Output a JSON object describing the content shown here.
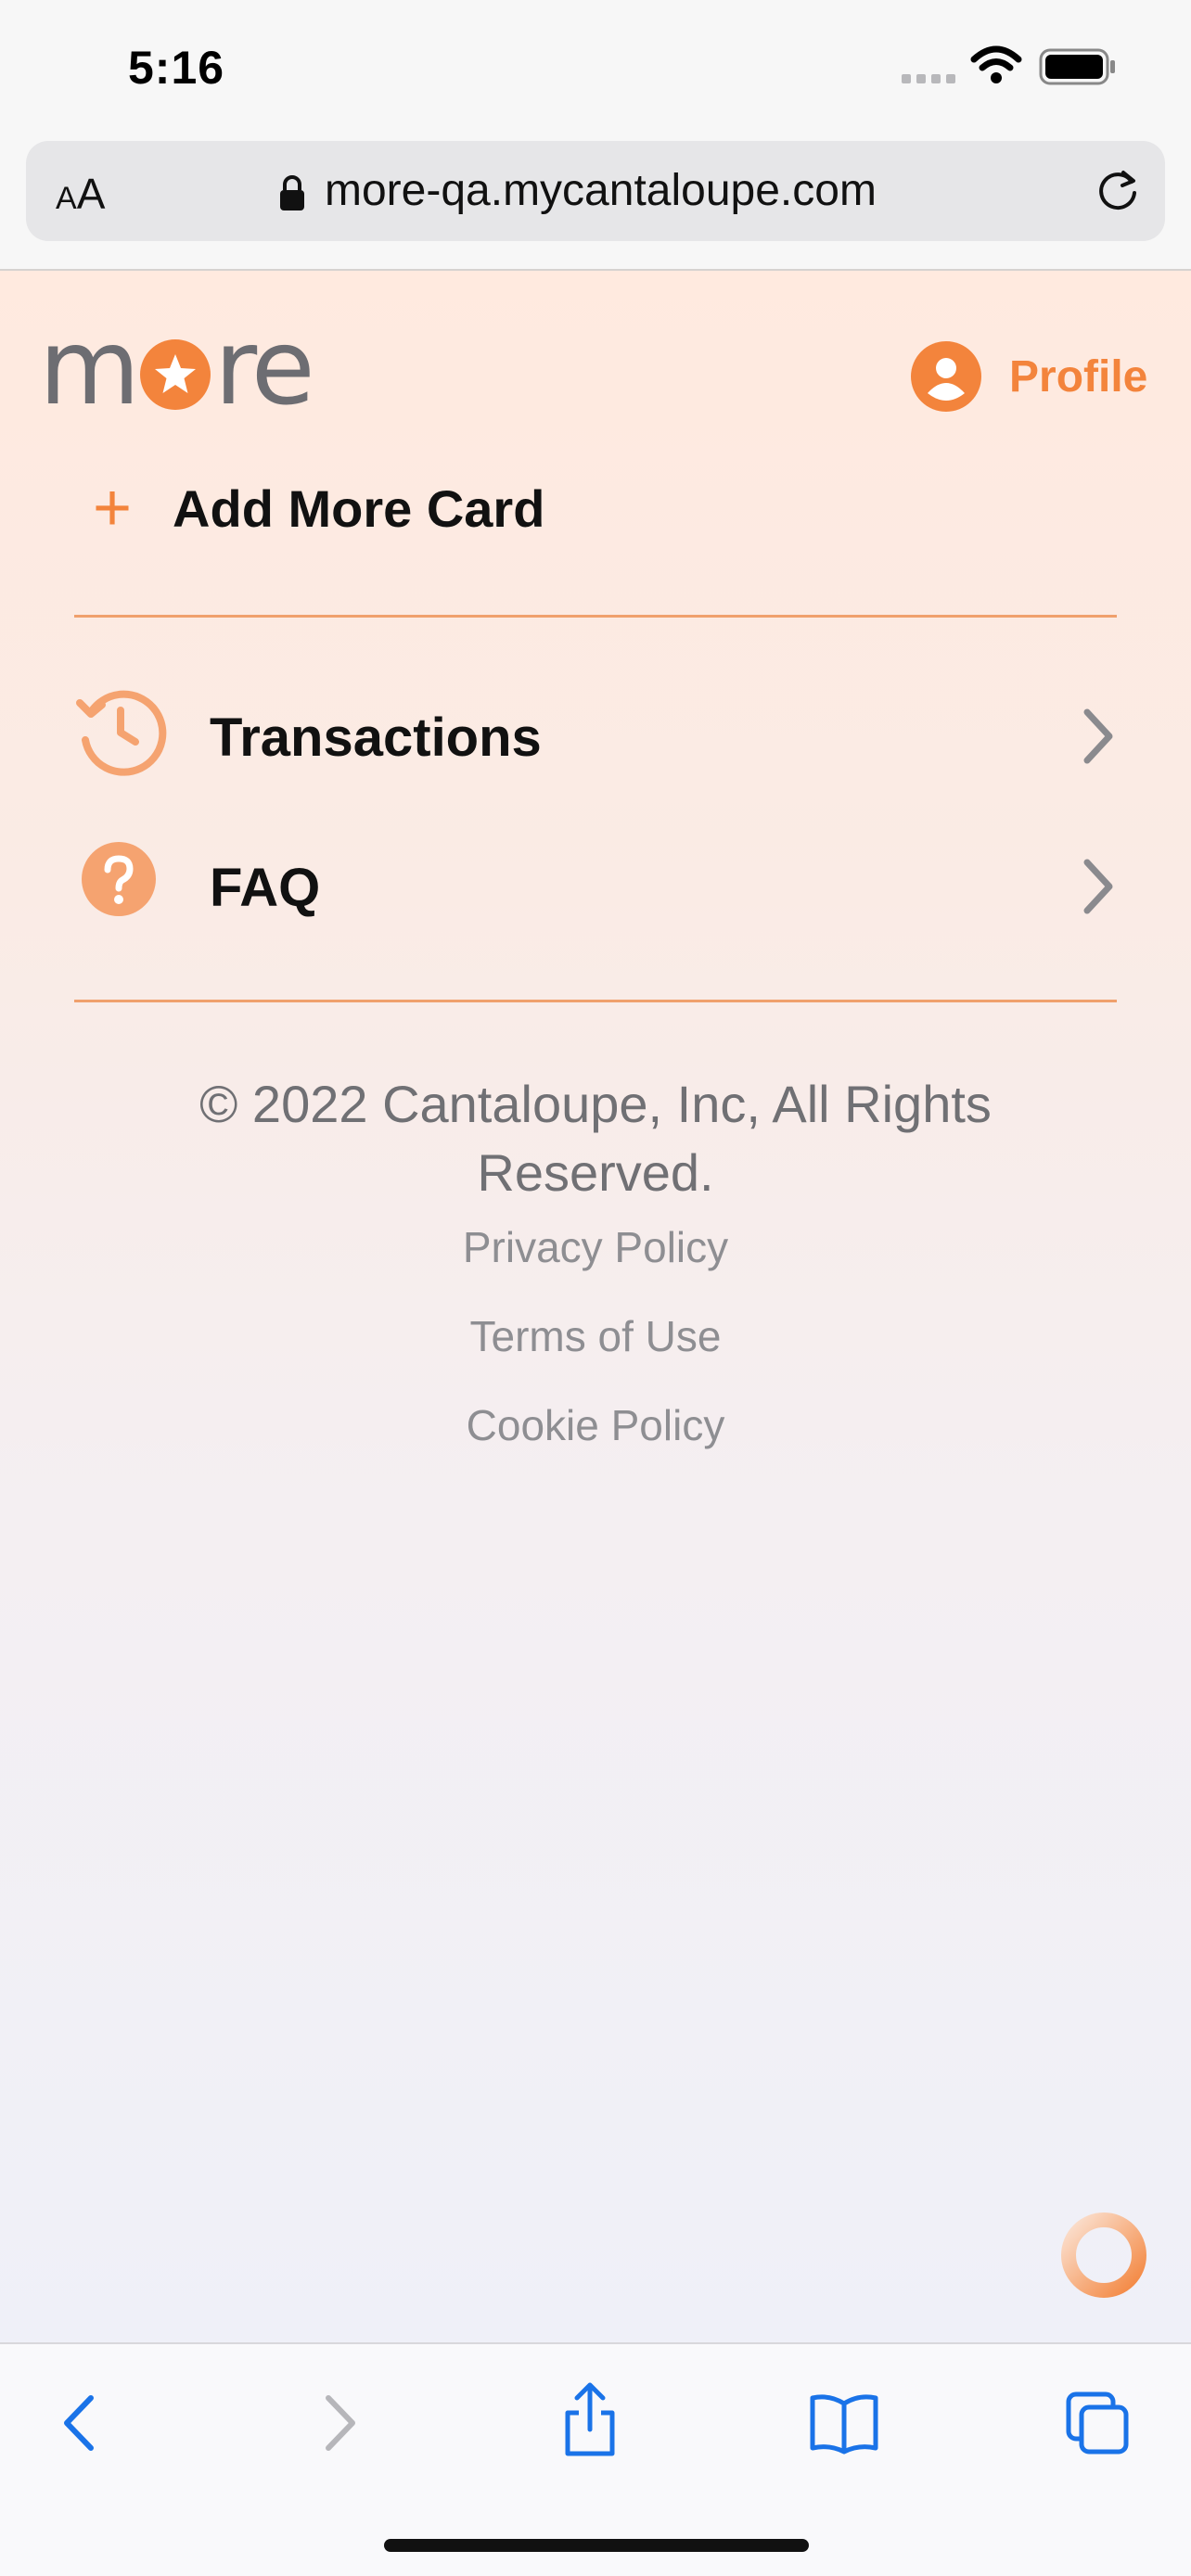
{
  "status_bar": {
    "time": "5:16",
    "icons": [
      "signal-icon",
      "wifi-icon",
      "battery-icon"
    ]
  },
  "browser": {
    "text_size_small": "A",
    "text_size_large": "A",
    "url": "more-qa.mycantaloupe.com",
    "icons": [
      "lock-icon",
      "reload-icon"
    ]
  },
  "header": {
    "logo_alt": "more",
    "logo_left": "m",
    "logo_right": "re",
    "profile_label": "Profile"
  },
  "menu": {
    "add_card": {
      "icon": "+",
      "label": "Add More Card"
    },
    "items": [
      {
        "label": "Transactions",
        "icon": "history-clock-icon"
      },
      {
        "label": "FAQ",
        "icon": "question-circle-icon"
      }
    ]
  },
  "footer": {
    "copyright": "© 2022 Cantaloupe, Inc, All Rights Reserved.",
    "links": [
      "Privacy Policy",
      "Terms of Use",
      "Cookie Policy"
    ]
  },
  "toolbar": {
    "icons": [
      "back-icon",
      "forward-icon",
      "share-icon",
      "bookmarks-icon",
      "tabs-icon"
    ]
  },
  "colors": {
    "accent": "#f3843c",
    "accent_light": "#f5a370",
    "text_dark": "#111111",
    "text_muted": "#707074",
    "ios_blue": "#1a73e8"
  }
}
